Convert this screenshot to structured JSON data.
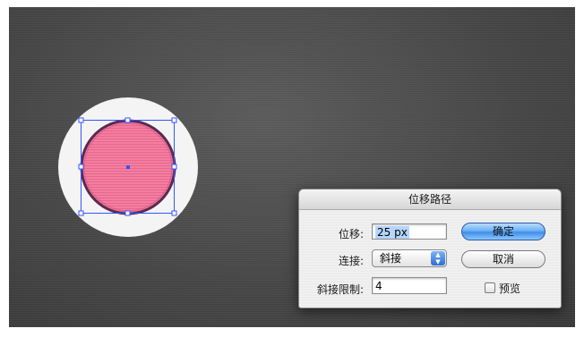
{
  "dialog": {
    "title": "位移路径",
    "offset_label": "位移:",
    "offset_value": "25 px",
    "joins_label": "连接:",
    "joins_value": "斜接",
    "miter_label": "斜接限制:",
    "miter_value": "4",
    "ok_label": "确定",
    "cancel_label": "取消",
    "preview_label": "预览",
    "preview_checked": false
  },
  "colors": {
    "canvas": "#474747",
    "shape_fill": "#f07a9c",
    "shape_stroke": "#5a2a52",
    "selection": "#3355ff",
    "accent": "#3f8ee8"
  }
}
